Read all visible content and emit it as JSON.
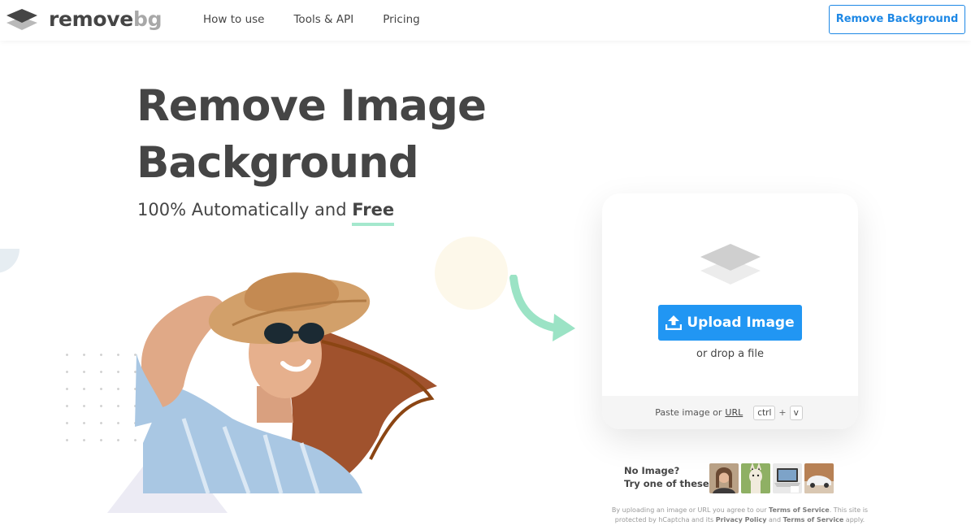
{
  "header": {
    "logo_part1": "remove",
    "logo_part2": "bg",
    "nav": [
      "How to use",
      "Tools & API",
      "Pricing"
    ],
    "cta_label": "Remove Background"
  },
  "hero": {
    "title_line1": "Remove Image",
    "title_line2": "Background",
    "subtitle_prefix": "100% Automatically and",
    "subtitle_emphasis": "Free"
  },
  "upload": {
    "button_label": "Upload Image",
    "drop_text": "or drop a file",
    "paste_text": "Paste image or",
    "url_text": "URL",
    "key_ctrl": "ctrl",
    "key_plus": "+",
    "key_v": "v"
  },
  "samples": {
    "line1": "No Image?",
    "line2": "Try one of these:",
    "thumbs": [
      "woman-sample-icon",
      "llama-sample-icon",
      "laptop-sample-icon",
      "car-sample-icon"
    ]
  },
  "legal": {
    "part1": "By uploading an image or URL you agree to our",
    "tos1": "Terms of Service",
    "part2": ". This site is protected by hCaptcha and its",
    "privacy": "Privacy Policy",
    "part3": "and",
    "tos2": "Terms of Service",
    "part4": "apply."
  },
  "colors": {
    "accent_blue": "#2196f3",
    "cta_blue": "#1e88e5",
    "text": "#454545",
    "arrow_green": "#9be3c5",
    "free_underline": "#a4e8cd"
  }
}
